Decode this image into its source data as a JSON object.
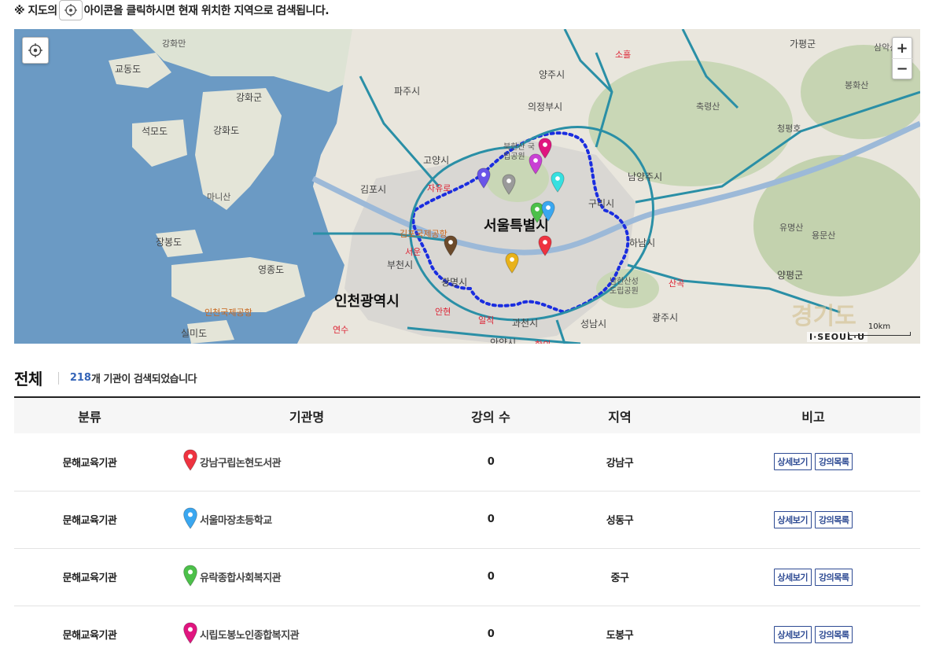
{
  "notice": {
    "prefix": "※ 지도의",
    "suffix": "아이콘을 클릭하시면 현재 위치한 지역으로 검색됩니다."
  },
  "map": {
    "zoom_in": "+",
    "zoom_out": "−",
    "scale_label": "10km",
    "logo": "I·SEOUL·U",
    "labels": {
      "seoul": "서울특별시",
      "incheon": "인천광역시",
      "gyeonggi": "경기도",
      "gangwha_man": "강화만",
      "gyodongdo": "교동도",
      "ganghwagun": "강화군",
      "seokmodo": "석모도",
      "ganghwado": "강화도",
      "manisan": "마니산",
      "jangbongdo": "장봉도",
      "yeongjongdo": "영종도",
      "incheon_airport": "인천국제공항",
      "silmido": "실미도",
      "pajusi": "파주시",
      "goyangsi": "고양시",
      "gimposi": "김포시",
      "bucheonsi": "부천시",
      "gwangmyeong": "광명시",
      "gwacheonsi": "과천시",
      "anyangsi": "안양시",
      "seongnamsi": "성남시",
      "hanamsi": "하남시",
      "guri": "구리시",
      "namyangjusi": "남양주시",
      "uijeongbusi": "의정부시",
      "yangjusi": "양주시",
      "gapyeonggun": "가평군",
      "gwangjusi": "광주시",
      "yangpyeonggun": "양평군",
      "gimpo_airport": "김포국제공항",
      "namhansan": "남한산성 도립공원",
      "yumyeongsan": "유명산",
      "yongmunsan": "용문산",
      "chukryeongsan": "축령산",
      "bonghwasan": "봉화산",
      "samaksan": "삼악산",
      "cheongpyeong": "청평호",
      "jc_soheul": "소흘",
      "jc_jayuro": "자유로",
      "jc_seoun": "서운",
      "jc_incheon": "안현",
      "jc_ilijk": "일직",
      "jc_yeonsu": "연수",
      "jc_sangok": "산곡",
      "jc_hagui": "학의",
      "bukhansan": "북한산 국립공원"
    }
  },
  "summary": {
    "title": "전체",
    "count": "218",
    "count_text": "개 기관이 검색되었습니다"
  },
  "table": {
    "headers": [
      "분류",
      "기관명",
      "강의 수",
      "지역",
      "비고"
    ],
    "rows": [
      {
        "category": "문해교육기관",
        "name": "강남구립논현도서관",
        "lectures": "0",
        "region": "강남구",
        "detail_btn": "상세보기",
        "list_btn": "강의목록",
        "pin_color": "#ee3340"
      },
      {
        "category": "문해교육기관",
        "name": "서울마장초등학교",
        "lectures": "0",
        "region": "성동구",
        "detail_btn": "상세보기",
        "list_btn": "강의목록",
        "pin_color": "#3aa7f0"
      },
      {
        "category": "문해교육기관",
        "name": "유락종합사회복지관",
        "lectures": "0",
        "region": "중구",
        "detail_btn": "상세보기",
        "list_btn": "강의목록",
        "pin_color": "#4cc04a"
      },
      {
        "category": "문해교육기관",
        "name": "시립도봉노인종합복지관",
        "lectures": "0",
        "region": "도봉구",
        "detail_btn": "상세보기",
        "list_btn": "강의목록",
        "pin_color": "#e0157f"
      }
    ]
  },
  "map_pins": [
    {
      "name": "pin-magenta",
      "color": "#e0157f"
    },
    {
      "name": "pin-violet",
      "color": "#c940d4"
    },
    {
      "name": "pin-purple",
      "color": "#6a55e8"
    },
    {
      "name": "pin-gray",
      "color": "#9a9a9a"
    },
    {
      "name": "pin-cyan",
      "color": "#36e0e0"
    },
    {
      "name": "pin-green",
      "color": "#4cc04a"
    },
    {
      "name": "pin-blue",
      "color": "#3aa7f0"
    },
    {
      "name": "pin-red",
      "color": "#ee3340"
    },
    {
      "name": "pin-brown",
      "color": "#6b4a2b"
    },
    {
      "name": "pin-yellow",
      "color": "#e8b21a"
    }
  ]
}
